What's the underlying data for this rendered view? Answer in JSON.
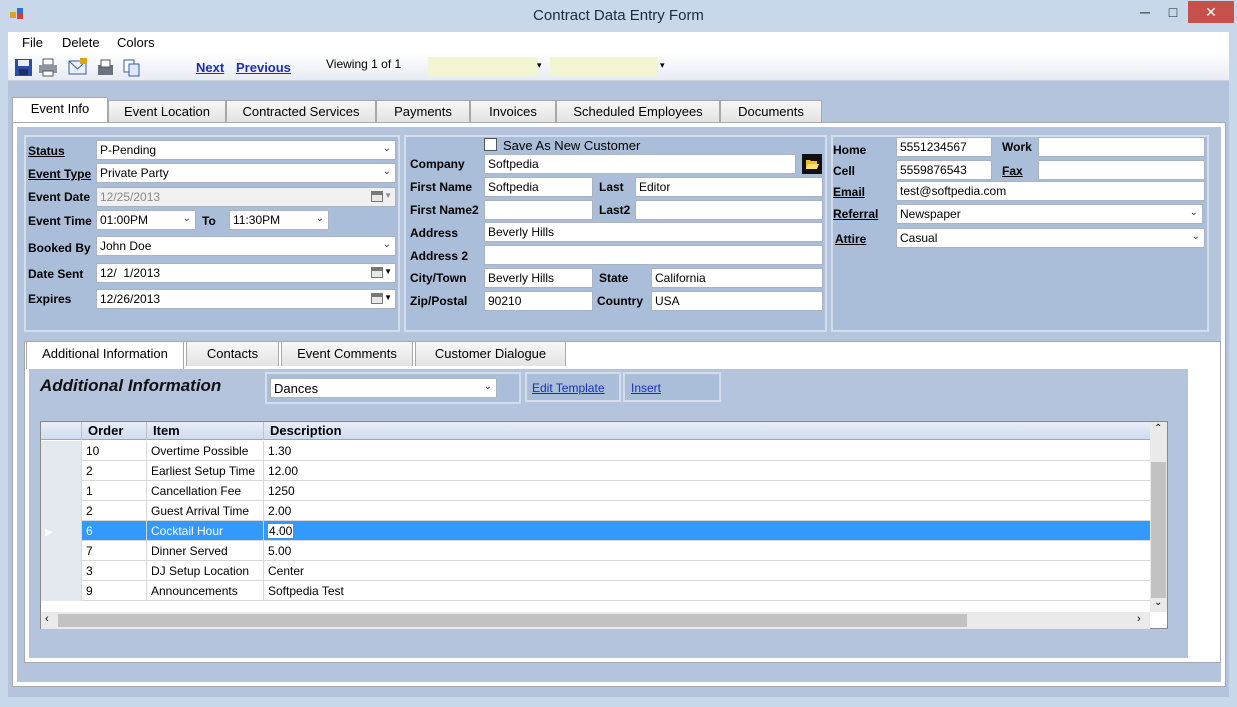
{
  "window": {
    "title": "Contract Data Entry Form",
    "min": "─",
    "max": "□",
    "close": "✕"
  },
  "menu": {
    "file": "File",
    "delete": "Delete",
    "colors": "Colors"
  },
  "toolbar": {
    "next": "Next",
    "previous": "Previous",
    "viewing": "Viewing 1 of 1"
  },
  "tabs": [
    "Event Info",
    "Event Location",
    "Contracted Services",
    "Payments",
    "Invoices",
    "Scheduled Employees",
    "Documents"
  ],
  "event": {
    "status_label": "Status",
    "status_value": "P-Pending",
    "event_type_label": "Event Type",
    "event_type_value": "Private Party",
    "event_date_label": "Event Date",
    "event_date_value": "12/25/2013",
    "event_time_label": "Event Time",
    "event_time_value": "01:00PM",
    "to_label": "To",
    "to_value": "11:30PM",
    "booked_by_label": "Booked By",
    "booked_by_value": "John Doe",
    "date_sent_label": "Date Sent",
    "date_sent_value": "12/  1/2013",
    "expires_label": "Expires",
    "expires_value": "12/26/2013"
  },
  "customer": {
    "save_new_label": "Save As New Customer",
    "company_label": "Company",
    "company_value": "Softpedia",
    "first_name_label": "First Name",
    "first_name_value": "Softpedia",
    "last_label": "Last",
    "last_value": "Editor",
    "first_name2_label": "First Name2",
    "first_name2_value": "",
    "last2_label": "Last2",
    "last2_value": "",
    "address_label": "Address",
    "address_value": "Beverly Hills",
    "address2_label": "Address 2",
    "address2_value": "",
    "city_label": "City/Town",
    "city_value": "Beverly Hills",
    "state_label": "State",
    "state_value": "California",
    "zip_label": "Zip/Postal",
    "zip_value": "90210",
    "country_label": "Country",
    "country_value": "USA"
  },
  "contact": {
    "home_label": "Home",
    "home_value": "5551234567",
    "work_label": "Work",
    "work_value": "",
    "cell_label": "Cell",
    "cell_value": "5559876543",
    "fax_label": "Fax",
    "fax_value": "",
    "email_label": "Email",
    "email_value": "test@softpedia.com",
    "referral_label": "Referral",
    "referral_value": "Newspaper",
    "attire_label": "Attire",
    "attire_value": "Casual"
  },
  "subtabs": [
    "Additional Information",
    "Contacts",
    "Event Comments",
    "Customer Dialogue"
  ],
  "additional": {
    "heading": "Additional Information",
    "template_value": "Dances",
    "edit_template": "Edit Template",
    "insert": "Insert"
  },
  "grid": {
    "columns": [
      "Order",
      "Item",
      "Description"
    ],
    "rows": [
      {
        "order": "10",
        "item": "Overtime Possible",
        "description": "1.30"
      },
      {
        "order": "2",
        "item": "Earliest Setup Time",
        "description": "12.00"
      },
      {
        "order": "1",
        "item": "Cancellation Fee",
        "description": "1250"
      },
      {
        "order": "2",
        "item": "Guest Arrival Time",
        "description": "2.00"
      },
      {
        "order": "6",
        "item": "Cocktail Hour",
        "description": "4.00"
      },
      {
        "order": "7",
        "item": "Dinner Served",
        "description": "5.00"
      },
      {
        "order": "3",
        "item": "DJ Setup Location",
        "description": "Center"
      },
      {
        "order": "9",
        "item": "Announcements",
        "description": "Softpedia Test"
      }
    ]
  }
}
